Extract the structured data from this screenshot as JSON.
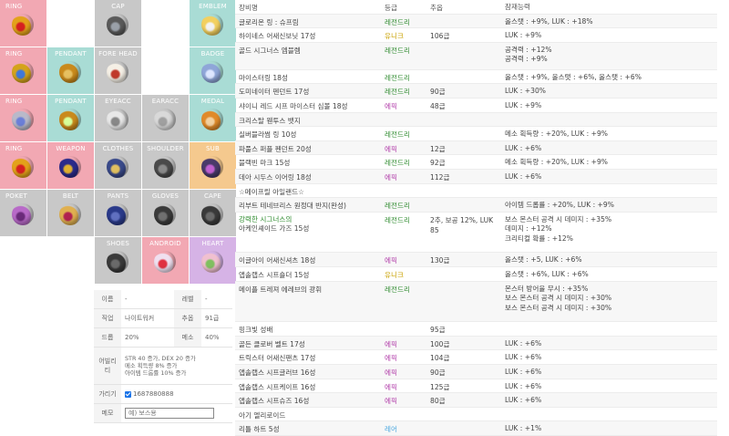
{
  "slots": [
    {
      "id": "ring1",
      "label": "RING",
      "color": "#f2a8b3",
      "item": "ring-gold-red"
    },
    {
      "id": "blank1",
      "label": "",
      "color": "#ffffff",
      "item": ""
    },
    {
      "id": "cap",
      "label": "CAP",
      "color": "#c8c8c8",
      "item": "helmet"
    },
    {
      "id": "blank2",
      "label": "",
      "color": "#ffffff",
      "item": ""
    },
    {
      "id": "emblem",
      "label": "EMBLEM",
      "color": "#a9dcd5",
      "item": "emblem"
    },
    {
      "id": "ring2",
      "label": "RING",
      "color": "#f2a8b3",
      "item": "ring-blue"
    },
    {
      "id": "pendant1",
      "label": "PENDANT",
      "color": "#a9dcd5",
      "item": "pendant-gold"
    },
    {
      "id": "forehead",
      "label": "FORE HEAD",
      "color": "#c8c8c8",
      "item": "card"
    },
    {
      "id": "blank3",
      "label": "",
      "color": "#ffffff",
      "item": ""
    },
    {
      "id": "badge",
      "label": "BADGE",
      "color": "#a9dcd5",
      "item": "badge"
    },
    {
      "id": "ring3",
      "label": "RING",
      "color": "#f2a8b3",
      "item": "ring-silver"
    },
    {
      "id": "pendant2",
      "label": "PENDANT",
      "color": "#a9dcd5",
      "item": "pendant-green"
    },
    {
      "id": "eyeacc",
      "label": "EYEACC",
      "color": "#c8c8c8",
      "item": "card-gray"
    },
    {
      "id": "earacc",
      "label": "EARACC",
      "color": "#c8c8c8",
      "item": "earring"
    },
    {
      "id": "medal",
      "label": "MEDAL",
      "color": "#a9dcd5",
      "item": "medal"
    },
    {
      "id": "ring4",
      "label": "RING",
      "color": "#f2a8b3",
      "item": "ring-gold-red"
    },
    {
      "id": "weapon",
      "label": "WEAPON",
      "color": "#f2a8b3",
      "item": "weapon"
    },
    {
      "id": "clothes",
      "label": "CLOTHES",
      "color": "#c8c8c8",
      "item": "clothes"
    },
    {
      "id": "shoulder",
      "label": "SHOULDER",
      "color": "#c8c8c8",
      "item": "shoulder"
    },
    {
      "id": "sub",
      "label": "SUB",
      "color": "#f5c98e",
      "item": "sub"
    },
    {
      "id": "poket",
      "label": "POKET",
      "color": "#c8c8c8",
      "item": "poket"
    },
    {
      "id": "belt",
      "label": "BELT",
      "color": "#c8c8c8",
      "item": "belt"
    },
    {
      "id": "pants",
      "label": "PANTS",
      "color": "#c8c8c8",
      "item": "pants"
    },
    {
      "id": "gloves",
      "label": "GLOVES",
      "color": "#c8c8c8",
      "item": "gloves"
    },
    {
      "id": "cape",
      "label": "CAPE",
      "color": "#c8c8c8",
      "item": "cape"
    },
    {
      "id": "blank4",
      "label": "",
      "color": "#ffffff",
      "item": ""
    },
    {
      "id": "blank5",
      "label": "",
      "color": "#ffffff",
      "item": ""
    },
    {
      "id": "shoes",
      "label": "SHOES",
      "color": "#c8c8c8",
      "item": "shoes"
    },
    {
      "id": "android",
      "label": "ANDROID",
      "color": "#f2a8b3",
      "item": "android"
    },
    {
      "id": "heart",
      "label": "HEART",
      "color": "#d6b3e6",
      "item": "heart"
    }
  ],
  "info": {
    "name_label": "이름",
    "name_value": "-",
    "level_label": "레벨",
    "level_value": "-",
    "job_label": "직업",
    "job_value": "나이트워커",
    "star_label": "추옵",
    "star_value": "91급",
    "drop_label": "드롭",
    "drop_value": "20%",
    "meso_label": "메소",
    "meso_value": "40%",
    "ability_label": "어빌리티",
    "ability_lines": [
      "STR 40 증가, DEX 20 증가",
      "메소 획득량 8% 증가",
      "아이템 드롭률 10% 증가"
    ],
    "hide_label": "가리기",
    "hide_value": "1687880888",
    "memo_label": "메모",
    "memo_placeholder": "예) 보스용"
  },
  "headers": {
    "name": "장비명",
    "grade": "등급",
    "star": "추옵",
    "potential": "잠재능력"
  },
  "rows": [
    {
      "name": "글로리온 링 : 슈프림",
      "grade": "레전드리",
      "gc": "legendary",
      "star": "",
      "opts": [
        "올스탯 : +9%, LUK : +18%"
      ],
      "h": 1
    },
    {
      "name": "하이네스 어새신보닛 17성",
      "grade": "유니크",
      "gc": "unique",
      "star": "106급",
      "opts": [
        "LUK : +9%"
      ],
      "h": 1
    },
    {
      "name": "골드 시그너스 엠블렘",
      "grade": "레전드리",
      "gc": "legendary",
      "star": "",
      "opts": [
        "공격력 : +12%",
        "공격력 : +9%"
      ],
      "h": 2
    },
    {
      "name": "마이스터링 18성",
      "grade": "레전드리",
      "gc": "legendary",
      "star": "",
      "opts": [
        "올스탯 : +9%, 올스탯 : +6%, 올스탯 : +6%"
      ],
      "h": 1
    },
    {
      "name": "도미네이터 펜던트 17성",
      "grade": "레전드리",
      "gc": "legendary",
      "star": "90급",
      "opts": [
        "LUK : +30%"
      ],
      "h": 1
    },
    {
      "name": "샤이니 레드 시프 마이스터 심볼 18성",
      "grade": "에픽",
      "gc": "epic",
      "star": "48급",
      "opts": [
        "LUK : +9%"
      ],
      "h": 1
    },
    {
      "name": "크리스탈 웬투스 뱃지",
      "grade": "",
      "gc": "",
      "star": "",
      "opts": [],
      "h": 1
    },
    {
      "name": "실버블라썸 링 10성",
      "grade": "레전드리",
      "gc": "legendary",
      "star": "",
      "opts": [
        "메소 획득량 : +20%, LUK : +9%"
      ],
      "h": 1
    },
    {
      "name": "파풀스 퍼플 펜던트 20성",
      "grade": "에픽",
      "gc": "epic",
      "star": "12급",
      "opts": [
        "LUK : +6%"
      ],
      "h": 1
    },
    {
      "name": "블랙빈 마크 15성",
      "grade": "레전드리",
      "gc": "legendary",
      "star": "92급",
      "opts": [
        "메소 획득량 : +20%, LUK : +9%"
      ],
      "h": 1
    },
    {
      "name": "데아 시두스 이어링 18성",
      "grade": "에픽",
      "gc": "epic",
      "star": "112급",
      "opts": [
        "LUK : +6%"
      ],
      "h": 1
    },
    {
      "name": "☆메이프릴 아일랜드☆",
      "grade": "",
      "gc": "",
      "star": "",
      "opts": [],
      "h": 1
    },
    {
      "name": "리부트 테네브리스 원정대 반지(완성)",
      "grade": "레전드리",
      "gc": "legendary",
      "star": "",
      "opts": [
        "아이템 드롭률 : +20%, LUK : +9%"
      ],
      "h": 1
    },
    {
      "name": "강력한 시그너스의",
      "name2": "아케인셰이드 가즈 15성",
      "nameGreen": true,
      "grade": "레전드리",
      "gc": "legendary",
      "star": "2추, 보공 12%, LUK",
      "star2": "85",
      "opts": [
        "보스 몬스터 공격 시 데미지 : +35%",
        "데미지 : +12%",
        "크리티컬 확률 : +12%"
      ],
      "h": 3
    },
    {
      "name": "이글아이 어새신셔츠 18성",
      "grade": "에픽",
      "gc": "epic",
      "star": "130급",
      "opts": [
        "올스탯 : +5, LUK : +6%"
      ],
      "h": 1
    },
    {
      "name": "앱솔랩스 시프숄더 15성",
      "grade": "유니크",
      "gc": "unique",
      "star": "",
      "opts": [
        "올스탯 : +6%, LUK : +6%"
      ],
      "h": 1
    },
    {
      "name": "메이플 트레져 에레브의 광휘",
      "grade": "레전드리",
      "gc": "legendary",
      "star": "",
      "opts": [
        "몬스터 방어율 무시 : +35%",
        "보스 몬스터 공격 시 데미지 : +30%",
        "보스 몬스터 공격 시 데미지 : +30%"
      ],
      "h": 3
    },
    {
      "name": "핑크빛 성배",
      "grade": "",
      "gc": "",
      "star": "95급",
      "opts": [],
      "h": 1
    },
    {
      "name": "골든 클로버 벨트 17성",
      "grade": "에픽",
      "gc": "epic",
      "star": "100급",
      "opts": [
        "LUK : +6%"
      ],
      "h": 1
    },
    {
      "name": "트릭스터 어새신팬츠 17성",
      "grade": "에픽",
      "gc": "epic",
      "star": "104급",
      "opts": [
        "LUK : +6%"
      ],
      "h": 1
    },
    {
      "name": "앱솔랩스 시프글러브 16성",
      "grade": "에픽",
      "gc": "epic",
      "star": "90급",
      "opts": [
        "LUK : +6%"
      ],
      "h": 1
    },
    {
      "name": "앱솔랩스 시프케이프 16성",
      "grade": "에픽",
      "gc": "epic",
      "star": "125급",
      "opts": [
        "LUK : +6%"
      ],
      "h": 1
    },
    {
      "name": "앱솔랩스 시프슈즈 16성",
      "grade": "에픽",
      "gc": "epic",
      "star": "80급",
      "opts": [
        "LUK : +6%"
      ],
      "h": 1
    },
    {
      "name": "아기 엘리로이드",
      "grade": "",
      "gc": "",
      "star": "",
      "opts": [],
      "h": 1
    },
    {
      "name": "리틀 하트 5성",
      "grade": "레어",
      "gc": "rare",
      "star": "",
      "opts": [
        "LUK : +1%"
      ],
      "h": 1
    }
  ]
}
